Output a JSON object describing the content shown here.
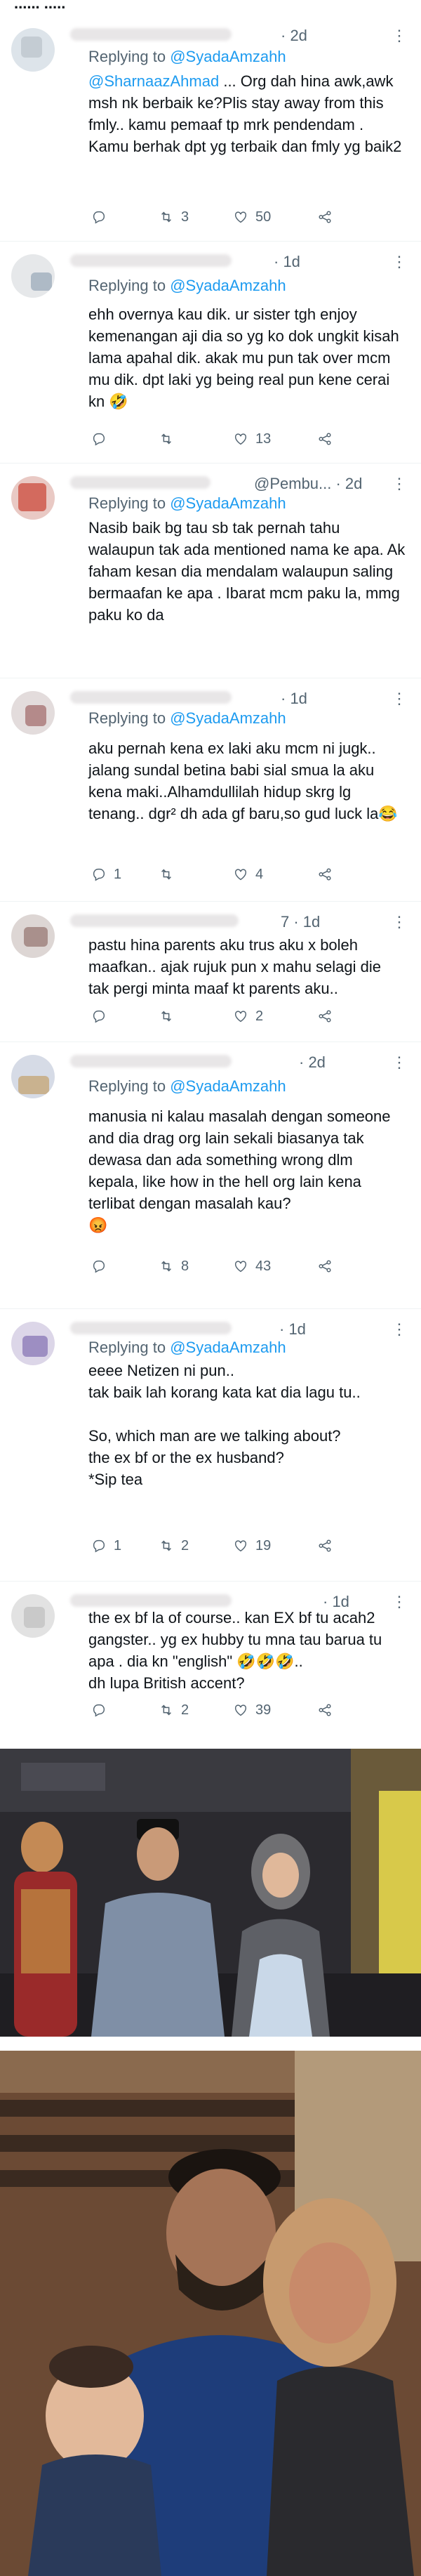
{
  "header_partial": "...... .....",
  "tweets": [
    {
      "meta": "· 2d",
      "reply_prefix": "Replying to",
      "reply_handle": "@SyadaAmzahh",
      "mention": "@SharnaazAhmad",
      "text": " ... Org dah hina awk,awk msh nk berbaik ke?Plis stay away from this fmly.. kamu pemaaf tp mrk pendendam . Kamu berhak dpt yg terbaik dan fmly yg baik2",
      "reply_count": "",
      "retweet_count": "3",
      "like_count": "50"
    },
    {
      "meta": "· 1d",
      "reply_prefix": "Replying to",
      "reply_handle": "@SyadaAmzahh",
      "text": "ehh overnya kau dik. ur sister tgh enjoy kemenangan aji dia so yg ko dok ungkit kisah lama apahal dik. akak mu pun tak over mcm mu dik. dpt laki yg being real pun kene cerai kn 🤣",
      "reply_count": "",
      "retweet_count": "",
      "like_count": "13"
    },
    {
      "meta": "@Pembu... · 2d",
      "reply_prefix": "Replying to",
      "reply_handle": "@SyadaAmzahh",
      "text": "Nasib baik bg tau sb tak pernah tahu walaupun tak ada mentioned nama ke apa. Ak faham kesan dia mendalam walaupun saling bermaafan ke apa . Ibarat mcm paku la, mmg paku ko da",
      "reply_count": "",
      "retweet_count": "",
      "like_count": ""
    },
    {
      "meta": "· 1d",
      "reply_prefix": "Replying to",
      "reply_handle": "@SyadaAmzahh",
      "text": "aku pernah kena ex laki aku mcm ni jugk.. jalang sundal betina babi sial smua la aku kena maki..Alhamdullilah hidup skrg lg tenang.. dgr² dh ada gf baru,so gud luck la😂",
      "reply_count": "1",
      "retweet_count": "",
      "like_count": "4"
    },
    {
      "meta": "7 · 1d",
      "text": "pastu hina parents aku trus aku x boleh maafkan.. ajak rujuk pun x mahu selagi die tak pergi minta maaf kt parents aku..",
      "reply_count": "",
      "retweet_count": "",
      "like_count": "2"
    },
    {
      "meta": "· 2d",
      "reply_prefix": "Replying to",
      "reply_handle": "@SyadaAmzahh",
      "text": "manusia ni kalau masalah dengan someone and dia drag org lain sekali biasanya tak dewasa dan ada something wrong dlm kepala, like how in the hell org lain kena terlibat dengan masalah kau?\n😡",
      "reply_count": "",
      "retweet_count": "8",
      "like_count": "43"
    },
    {
      "meta": "· 1d",
      "reply_prefix": "Replying to",
      "reply_handle": "@SyadaAmzahh",
      "text": "eeee Netizen ni pun..\ntak baik lah korang kata kat dia lagu tu..\n\nSo, which man are we talking about?\nthe ex bf or the ex husband?\n*Sip tea",
      "reply_count": "1",
      "retweet_count": "2",
      "like_count": "19"
    },
    {
      "meta": "· 1d",
      "text": "the ex bf la of course.. kan EX bf tu acah2 gangster.. yg ex hubby tu mna tau barua tu apa . dia kn \"english\" 🤣🤣🤣..\ndh lupa British accent?",
      "reply_count": "",
      "retweet_count": "2",
      "like_count": "39"
    }
  ],
  "icons": {
    "reply": "reply-icon",
    "retweet": "retweet-icon",
    "like": "like-icon",
    "share": "share-icon",
    "more": "more-icon"
  },
  "colors": {
    "text": "#0f1419",
    "muted": "#536471",
    "link": "#1d9bf0"
  }
}
